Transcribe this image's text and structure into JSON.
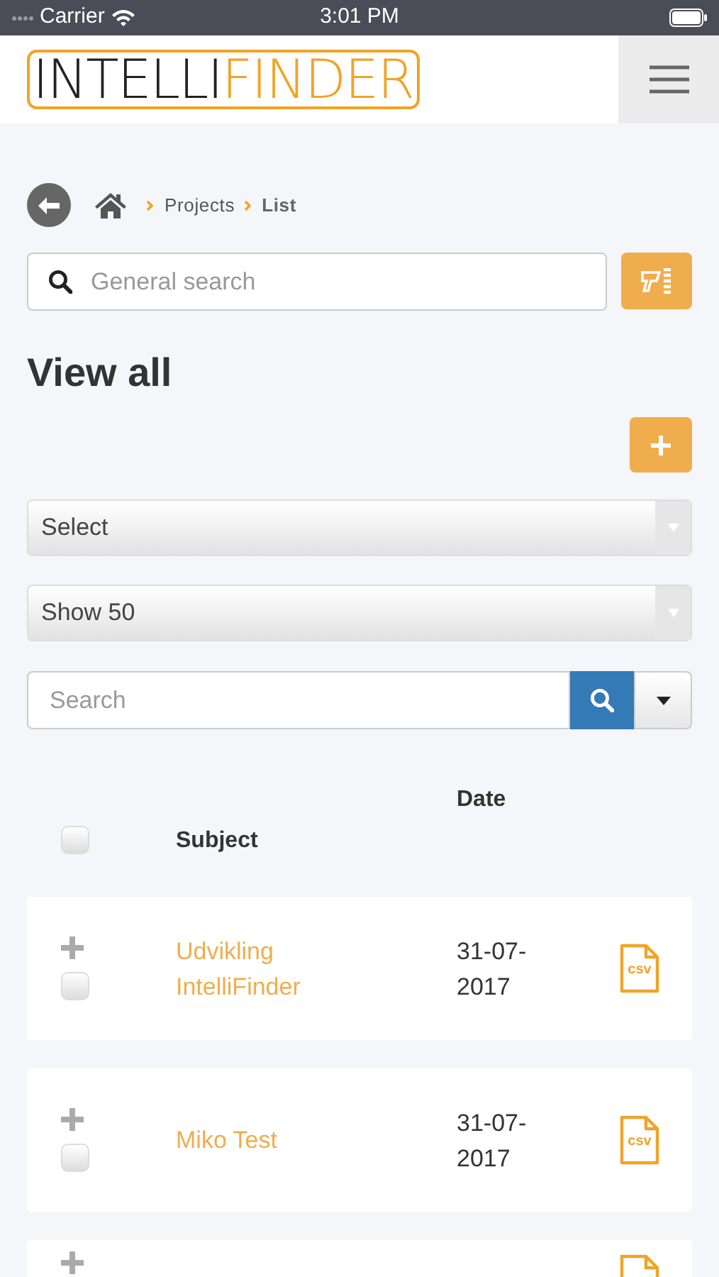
{
  "status_bar": {
    "carrier": "Carrier",
    "time": "3:01 PM"
  },
  "header": {
    "logo": [
      "INTELLI",
      "FINDER"
    ]
  },
  "breadcrumb": [
    "Projects",
    "List"
  ],
  "general_search": {
    "placeholder": "General search"
  },
  "title": "View all",
  "selects": [
    {
      "value": "Select"
    },
    {
      "value": "Show 50"
    }
  ],
  "table_search": {
    "placeholder": "Search"
  },
  "table": {
    "select_all_checked": false,
    "columns": [
      "Subject",
      "Date"
    ],
    "rows": [
      {
        "subject": [
          "Udvikling",
          "IntelliFinder"
        ],
        "date": [
          "31-07-",
          "2017"
        ],
        "file_label": "csv",
        "checked": false
      },
      {
        "subject": [
          "Miko Test"
        ],
        "date": [
          "31-07-",
          "2017"
        ],
        "file_label": "csv",
        "checked": false
      },
      {
        "kind": "partial"
      }
    ]
  }
}
